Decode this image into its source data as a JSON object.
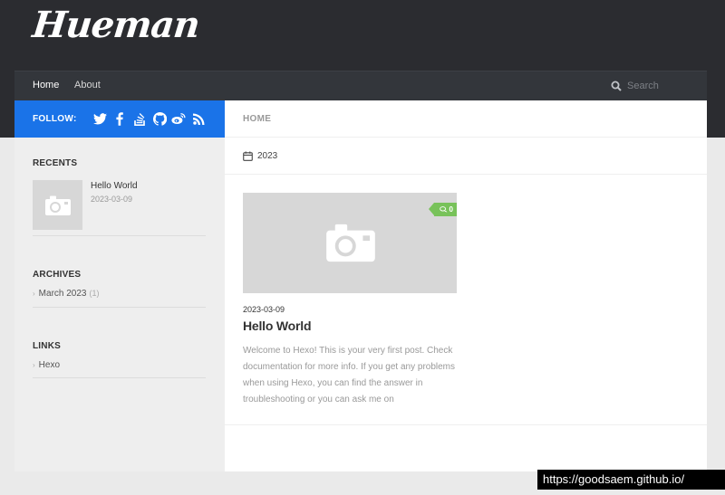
{
  "site": {
    "logo_text": "Hueman"
  },
  "nav": {
    "items": [
      {
        "label": "Home",
        "active": true
      },
      {
        "label": "About",
        "active": false
      }
    ],
    "search_placeholder": "Search"
  },
  "sidebar": {
    "follow_label": "FOLLOW:",
    "social_icons": [
      "twitter-icon",
      "facebook-icon",
      "stackoverflow-icon",
      "github-icon",
      "weibo-icon",
      "rss-icon"
    ],
    "recents": {
      "title": "RECENTS",
      "items": [
        {
          "title": "Hello World",
          "date": "2023-03-09"
        }
      ]
    },
    "archives": {
      "title": "ARCHIVES",
      "items": [
        {
          "label": "March 2023",
          "count": "(1)"
        }
      ]
    },
    "links": {
      "title": "LINKS",
      "items": [
        {
          "label": "Hexo"
        }
      ]
    }
  },
  "main": {
    "page_heading": "HOME",
    "archive_year": "2023",
    "posts": [
      {
        "date": "2023-03-09",
        "title": "Hello World",
        "comment_count": "0",
        "excerpt": "Welcome to Hexo! This is your very first post. Check documentation for more info. If you get any problems when using Hexo, you can find the answer in troubleshooting or you can ask me on"
      }
    ]
  },
  "watermark": "https://goodsaem.github.io/",
  "colors": {
    "header_bg": "#2b2c30",
    "nav_bg": "#33363b",
    "follow_bar": "#1a73e8",
    "comment_badge": "#78c25a"
  }
}
